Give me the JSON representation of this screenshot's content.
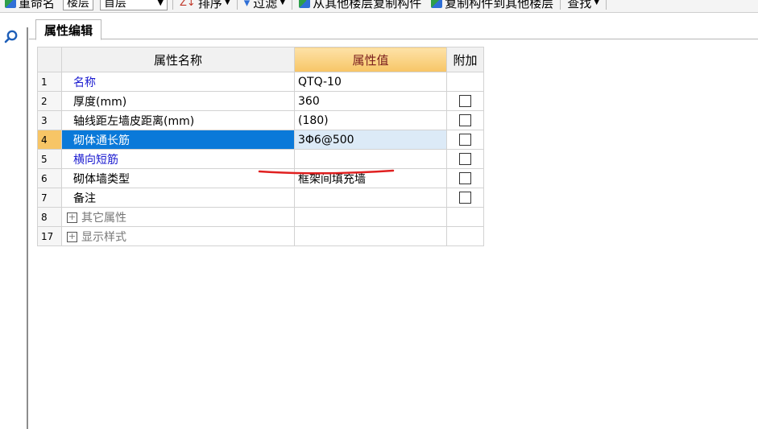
{
  "toolbar": {
    "rename_label": "重命名",
    "floor_label": "楼层",
    "floor_value": "首层",
    "sort_label": "排序",
    "filter_label": "过滤",
    "copy_from_label": "从其他楼层复制构件",
    "copy_to_label": "复制构件到其他楼层",
    "find_label": "查找"
  },
  "tabs": {
    "properties": "属性编辑"
  },
  "grid": {
    "headers": {
      "name": "属性名称",
      "value": "属性值",
      "extra": "附加"
    },
    "rows": [
      {
        "idx": "1",
        "name": "名称",
        "value": "QTQ-10"
      },
      {
        "idx": "2",
        "name": "厚度(mm)",
        "value": "360"
      },
      {
        "idx": "3",
        "name": "轴线距左墙皮距离(mm)",
        "value": "(180)"
      },
      {
        "idx": "4",
        "name": "砌体通长筋",
        "value": "3Φ6@500"
      },
      {
        "idx": "5",
        "name": "横向短筋",
        "value": ""
      },
      {
        "idx": "6",
        "name": "砌体墙类型",
        "value": "框架间填充墙"
      },
      {
        "idx": "7",
        "name": "备注",
        "value": ""
      },
      {
        "idx": "8",
        "name": "其它属性",
        "value": ""
      },
      {
        "idx": "17",
        "name": "显示样式",
        "value": ""
      }
    ]
  },
  "colors": {
    "selected_name_bg": "#0a79d9",
    "header_value_bg": "#f7c566",
    "blue_label": "#1b1bd0",
    "annotation_red": "#e02020"
  }
}
